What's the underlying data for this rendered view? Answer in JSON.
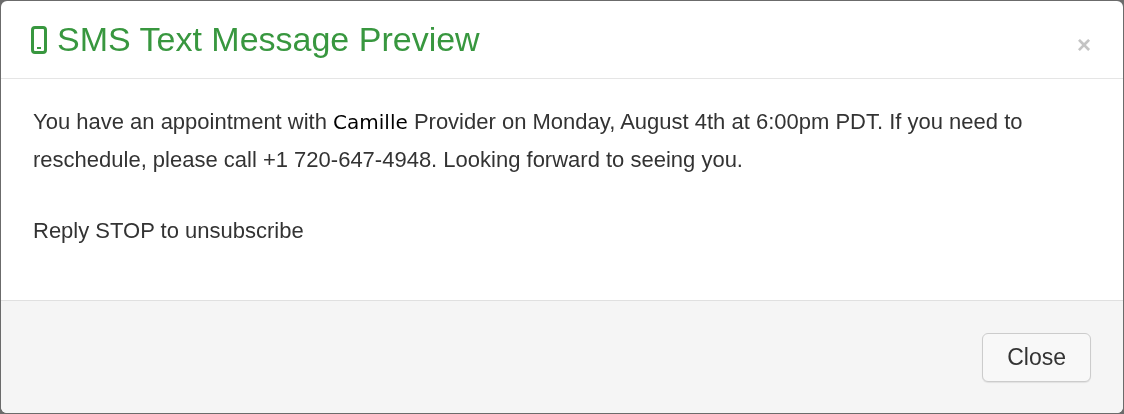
{
  "dialog": {
    "title": "SMS Text Message Preview",
    "close_glyph": "×",
    "message": [
      {
        "kind": "text",
        "text": "You have an appointment with "
      },
      {
        "kind": "name",
        "text": "Camille"
      },
      {
        "kind": "text",
        "text": " Provider on Monday, August 4th at 6:00pm PDT. If you need to reschedule, please call +1 720-647-4948. Looking forward to seeing you."
      }
    ],
    "footer_note": "Reply STOP to unsubscribe",
    "buttons": [
      "Close"
    ]
  }
}
